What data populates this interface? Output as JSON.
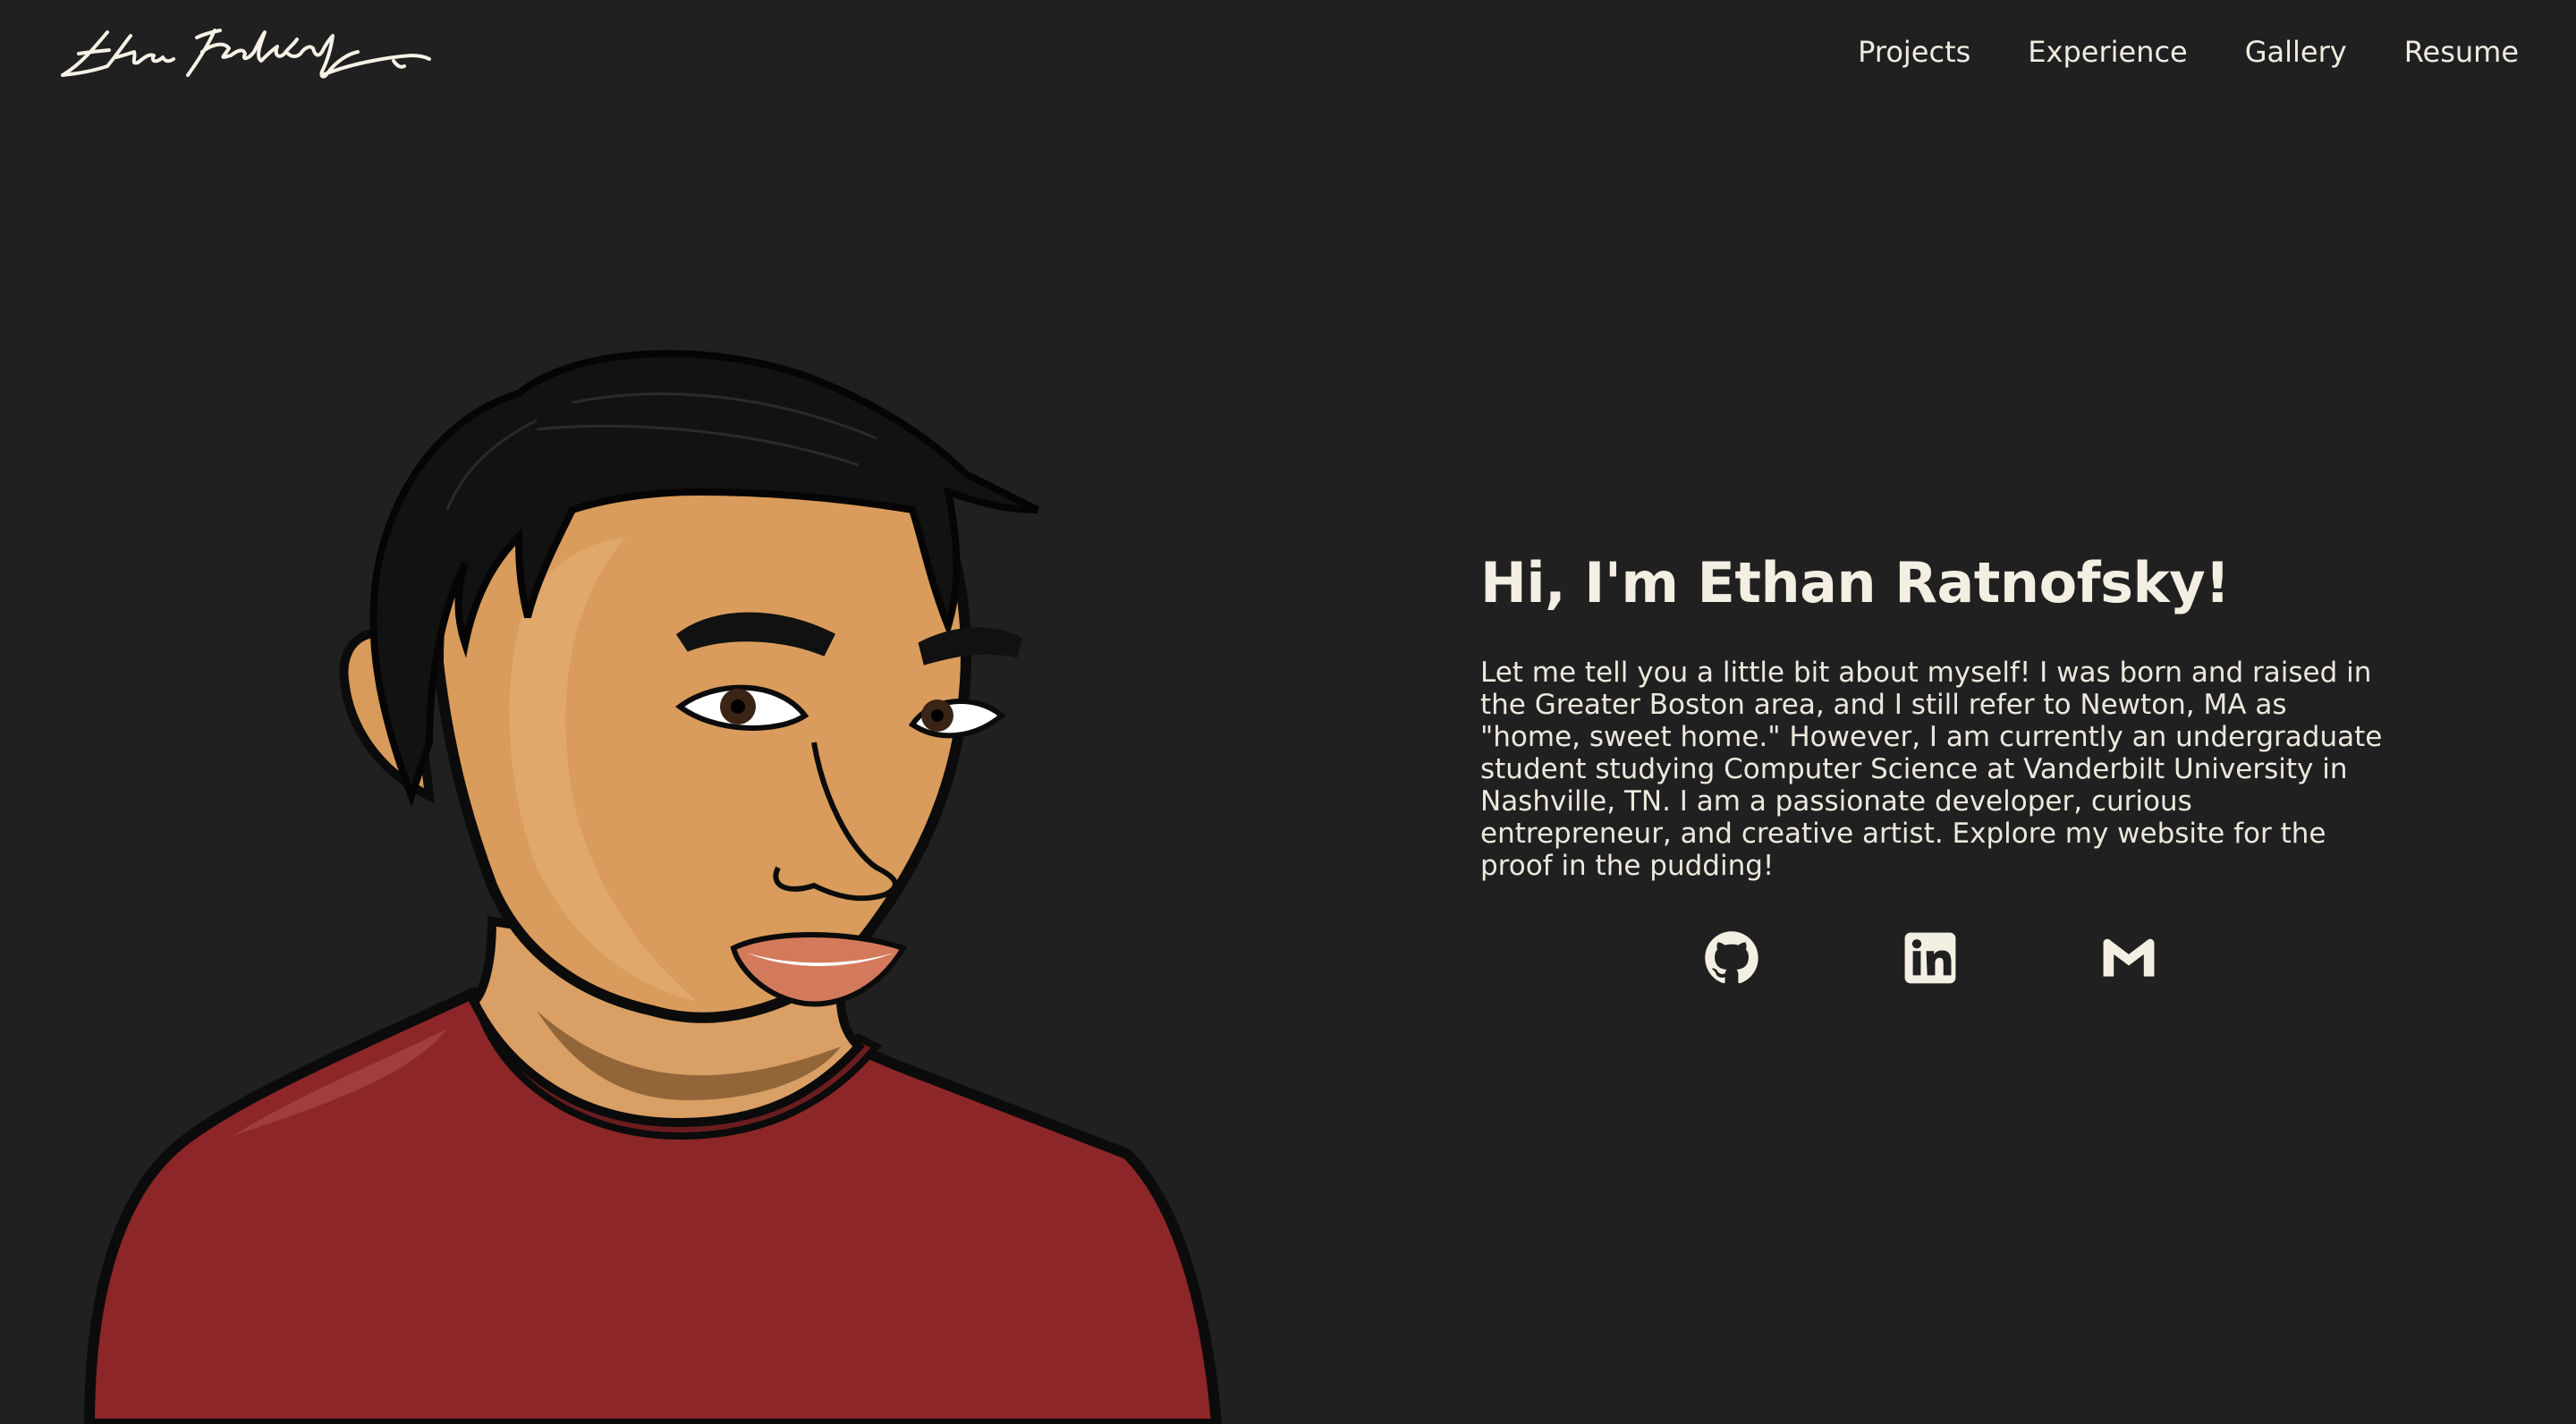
{
  "header": {
    "logo_alt": "Ethan Ratnofsky signature",
    "nav": [
      {
        "label": "Projects"
      },
      {
        "label": "Experience"
      },
      {
        "label": "Gallery"
      },
      {
        "label": "Resume"
      }
    ]
  },
  "hero": {
    "title": "Hi, I'm Ethan Ratnofsky!",
    "bio": "Let me tell you a little bit about myself! I was born and raised in the Greater Boston area, and I still refer to Newton, MA as \"home, sweet home.\" However, I am currently an undergraduate student studying Computer Science at Vanderbilt University in Nashville, TN. I am a passionate developer, curious entrepreneur, and creative artist. Explore my website for the proof in the pudding!"
  },
  "socials": [
    {
      "icon": "github-icon",
      "label": "GitHub"
    },
    {
      "icon": "linkedin-icon",
      "label": "LinkedIn"
    },
    {
      "icon": "gmail-icon",
      "label": "Email"
    }
  ],
  "colors": {
    "background": "#212021",
    "text": "#f3efe3",
    "shirt": "#8c2628",
    "skin": "#d89b5b"
  }
}
